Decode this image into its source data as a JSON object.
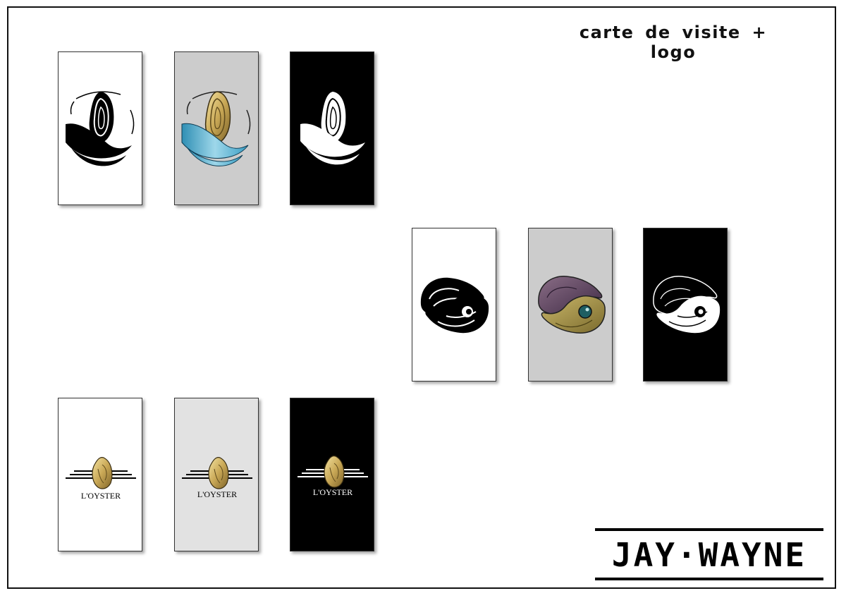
{
  "header": {
    "title": "carte de visite + logo"
  },
  "colors": {
    "white_card": "#ffffff",
    "grey_card": "#cccccc",
    "light_grey_card": "#e2e2e2",
    "black_card": "#000000",
    "water_blue": "#4aa8c8",
    "gold": "#c9a856",
    "plum": "#5b4160",
    "olive": "#9e8c45",
    "pearl_teal": "#1f5e62"
  },
  "row1": {
    "cards": [
      {
        "variant": "white",
        "logo": "wave-oyster-icon"
      },
      {
        "variant": "grey",
        "logo": "wave-oyster-icon"
      },
      {
        "variant": "black",
        "logo": "wave-oyster-icon"
      }
    ]
  },
  "row2": {
    "cards": [
      {
        "variant": "white",
        "logo": "yin-yang-oyster-icon"
      },
      {
        "variant": "grey",
        "logo": "yin-yang-oyster-icon"
      },
      {
        "variant": "black",
        "logo": "yin-yang-oyster-icon"
      }
    ]
  },
  "row3": {
    "brand": "L'OYSTER",
    "cards": [
      {
        "variant": "white",
        "logo": "gold-oyster-icon"
      },
      {
        "variant": "light-grey",
        "logo": "gold-oyster-icon"
      },
      {
        "variant": "black",
        "logo": "gold-oyster-icon"
      }
    ]
  },
  "signature": {
    "text": "JAY·WAYNE"
  }
}
